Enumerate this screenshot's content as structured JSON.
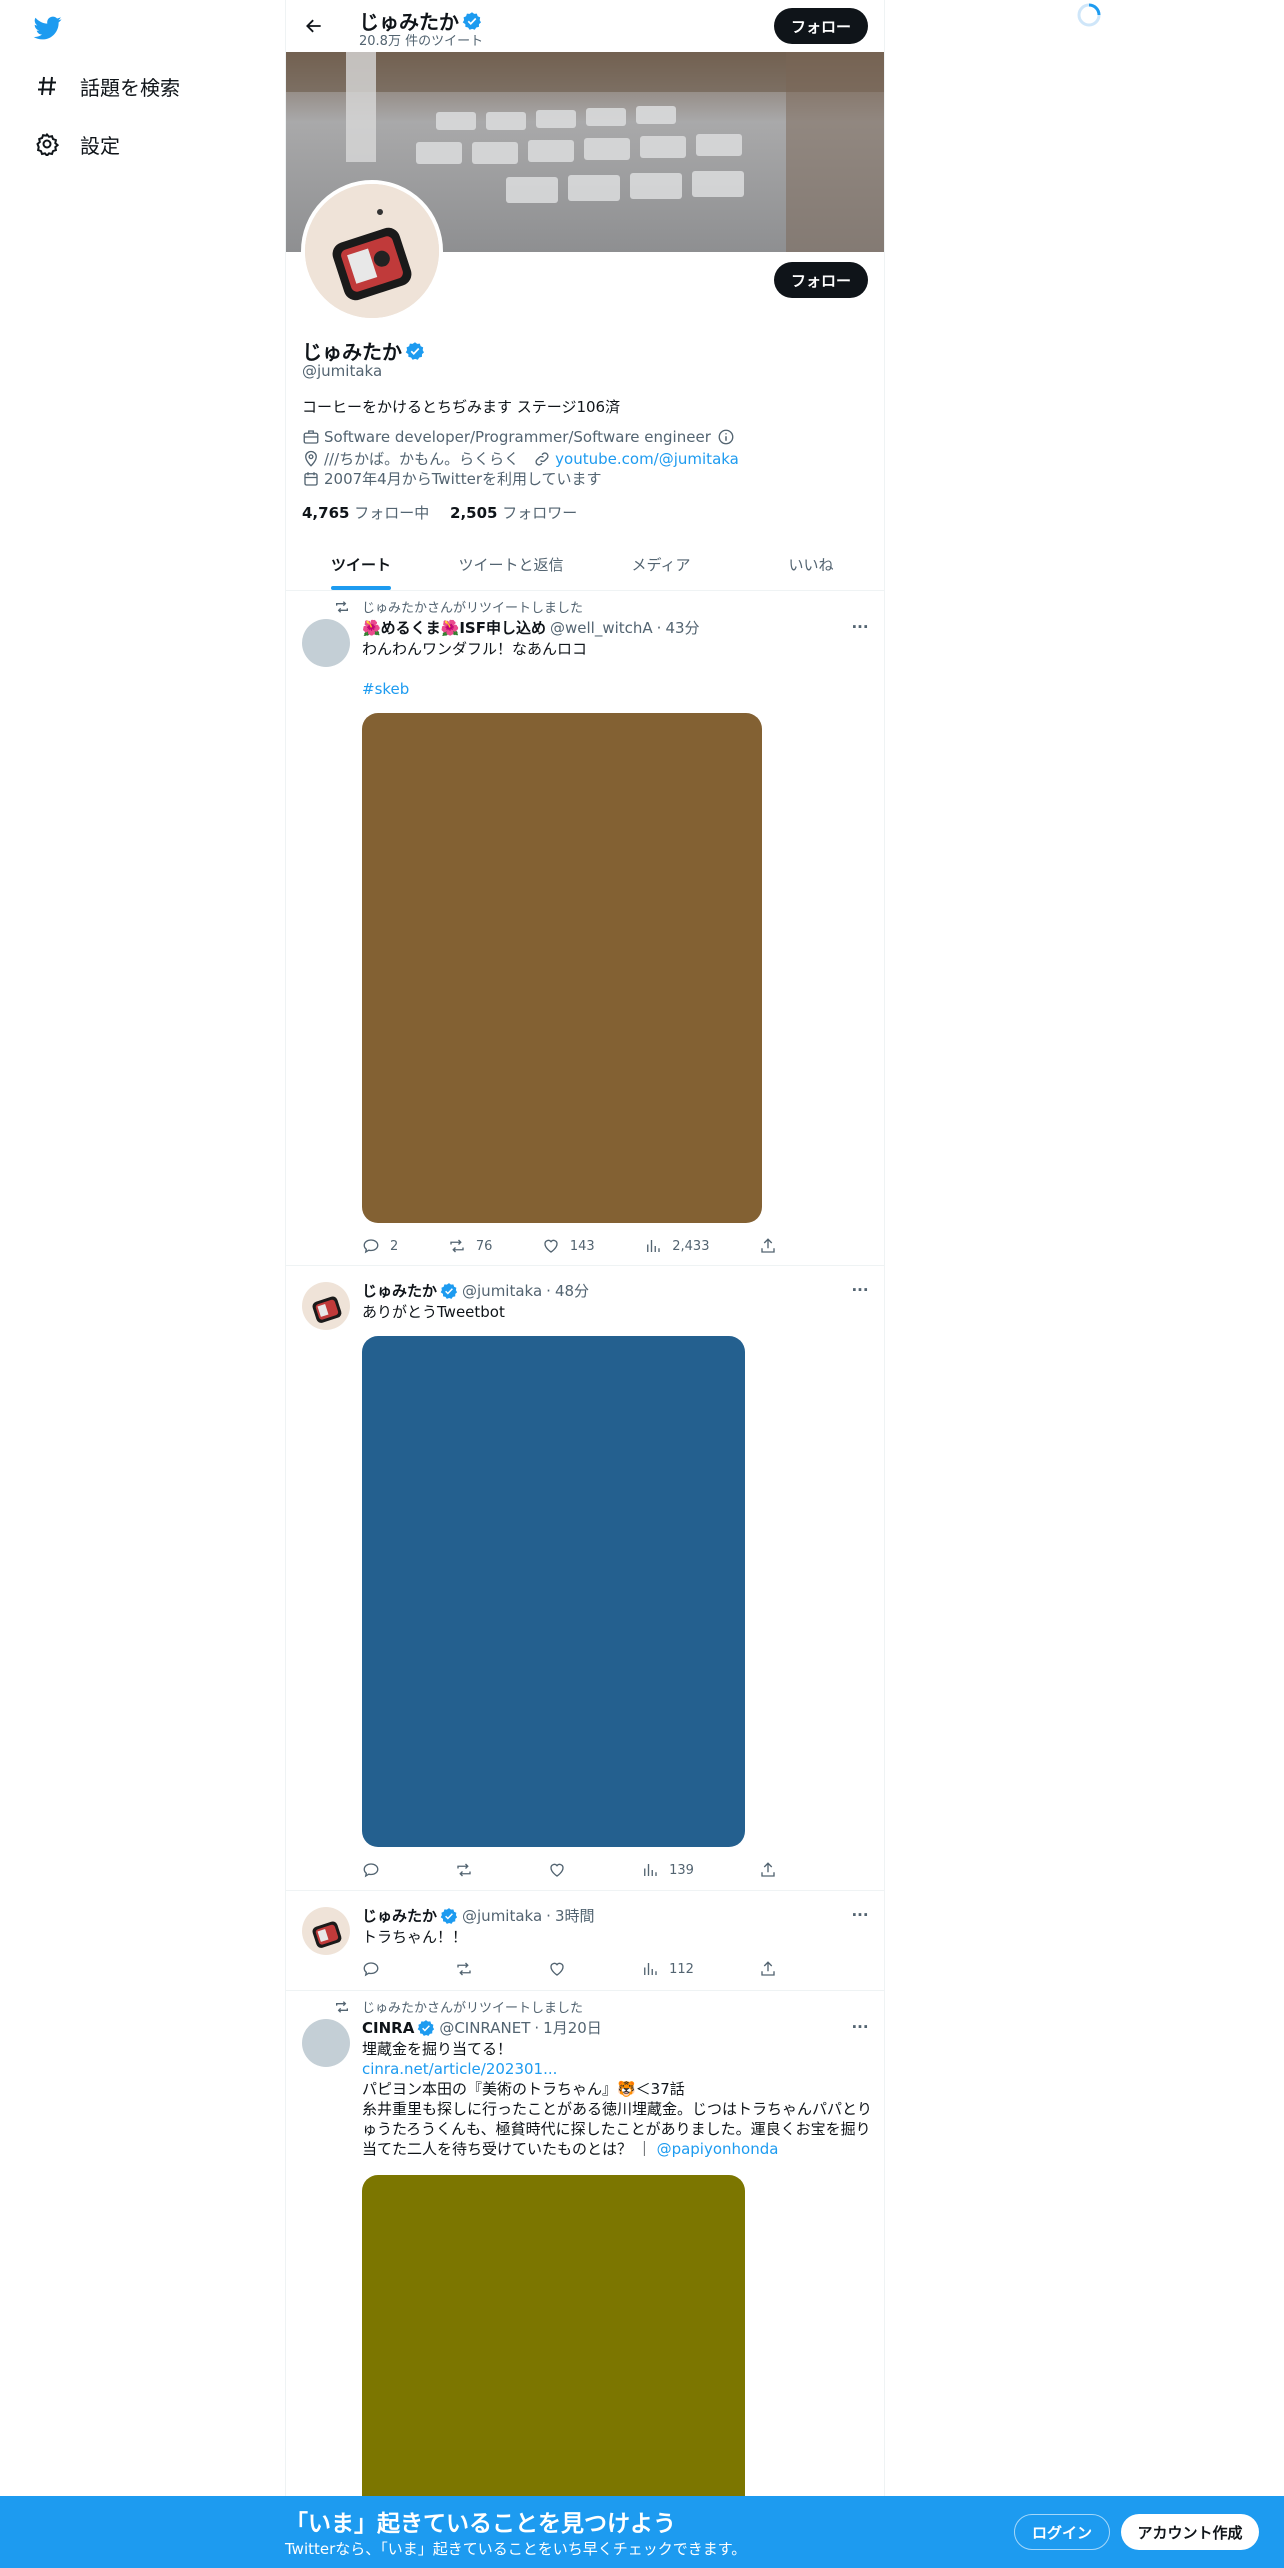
{
  "nav": {
    "items": [
      {
        "label": "話題を検索",
        "icon": "hashtag-icon"
      },
      {
        "label": "設定",
        "icon": "gear-icon"
      }
    ]
  },
  "header": {
    "name": "じゅみたか",
    "tweet_count": "20.8万 件のツイート",
    "follow_label": "フォロー"
  },
  "profile": {
    "name": "じゅみたか",
    "handle": "@jumitaka",
    "bio": "コーヒーをかけるとちぢみます ステージ106済",
    "category": "Software developer/Programmer/Software engineer",
    "location": "///ちかば。かもん。らくらく",
    "website": "youtube.com/@jumitaka",
    "joined": "2007年4月からTwitterを利用しています",
    "following_count": "4,765",
    "following_label": "フォロー中",
    "followers_count": "2,505",
    "followers_label": "フォロワー",
    "follow_label": "フォロー"
  },
  "tabs": [
    {
      "label": "ツイート",
      "active": true
    },
    {
      "label": "ツイートと返信",
      "active": false
    },
    {
      "label": "メディア",
      "active": false
    },
    {
      "label": "いいね",
      "active": false
    }
  ],
  "tweets": [
    {
      "retweet_notice": "じゅみたかさんがリツイートしました",
      "name": "🌺めるくま🌺ISF申し込め",
      "handle": "@well_witchA",
      "time": "43分",
      "text": "わんわんワンダフル！なあんロコ",
      "hashtag": "#skeb",
      "media_color": "#836133",
      "replies": "2",
      "retweets": "76",
      "likes": "143",
      "views": "2,433"
    },
    {
      "name": "じゅみたか",
      "handle": "@jumitaka",
      "time": "48分",
      "text": "ありがとうTweetbot",
      "media_color": "#24608f",
      "replies": "",
      "retweets": "",
      "likes": "",
      "views": "139"
    },
    {
      "name": "じゅみたか",
      "handle": "@jumitaka",
      "time": "3時間",
      "text": "トラちゃん！！",
      "replies": "",
      "retweets": "",
      "likes": "",
      "views": "112"
    },
    {
      "retweet_notice": "じゅみたかさんがリツイートしました",
      "name": "CINRA",
      "handle": "@CINRANET",
      "time": "1月20日",
      "line1": "埋蔵金を掘り当てる！",
      "link": "cinra.net/article/202301...",
      "line2": "パピヨン本田の『美術のトラちゃん』🐯＜37話",
      "line3": "糸井重里も探しに行ったことがある徳川埋蔵金。じつはトラちゃんパパとりゅうたろうくんも、極貧時代に探したことがありました。運良くお宝を掘り当てた二人を待ち受けていたものとは？ ｜",
      "mention": "@papiyonhonda",
      "media_color": "#7c7600"
    }
  ],
  "bottombar": {
    "title": "「いま」起きていることを見つけよう",
    "subtitle": "Twitterなら、「いま」起きていることをいち早くチェックできます。",
    "login_label": "ログイン",
    "signup_label": "アカウント作成"
  },
  "colors": {
    "accent": "#1d9bf0",
    "text": "#0f1419",
    "muted": "#536471"
  }
}
